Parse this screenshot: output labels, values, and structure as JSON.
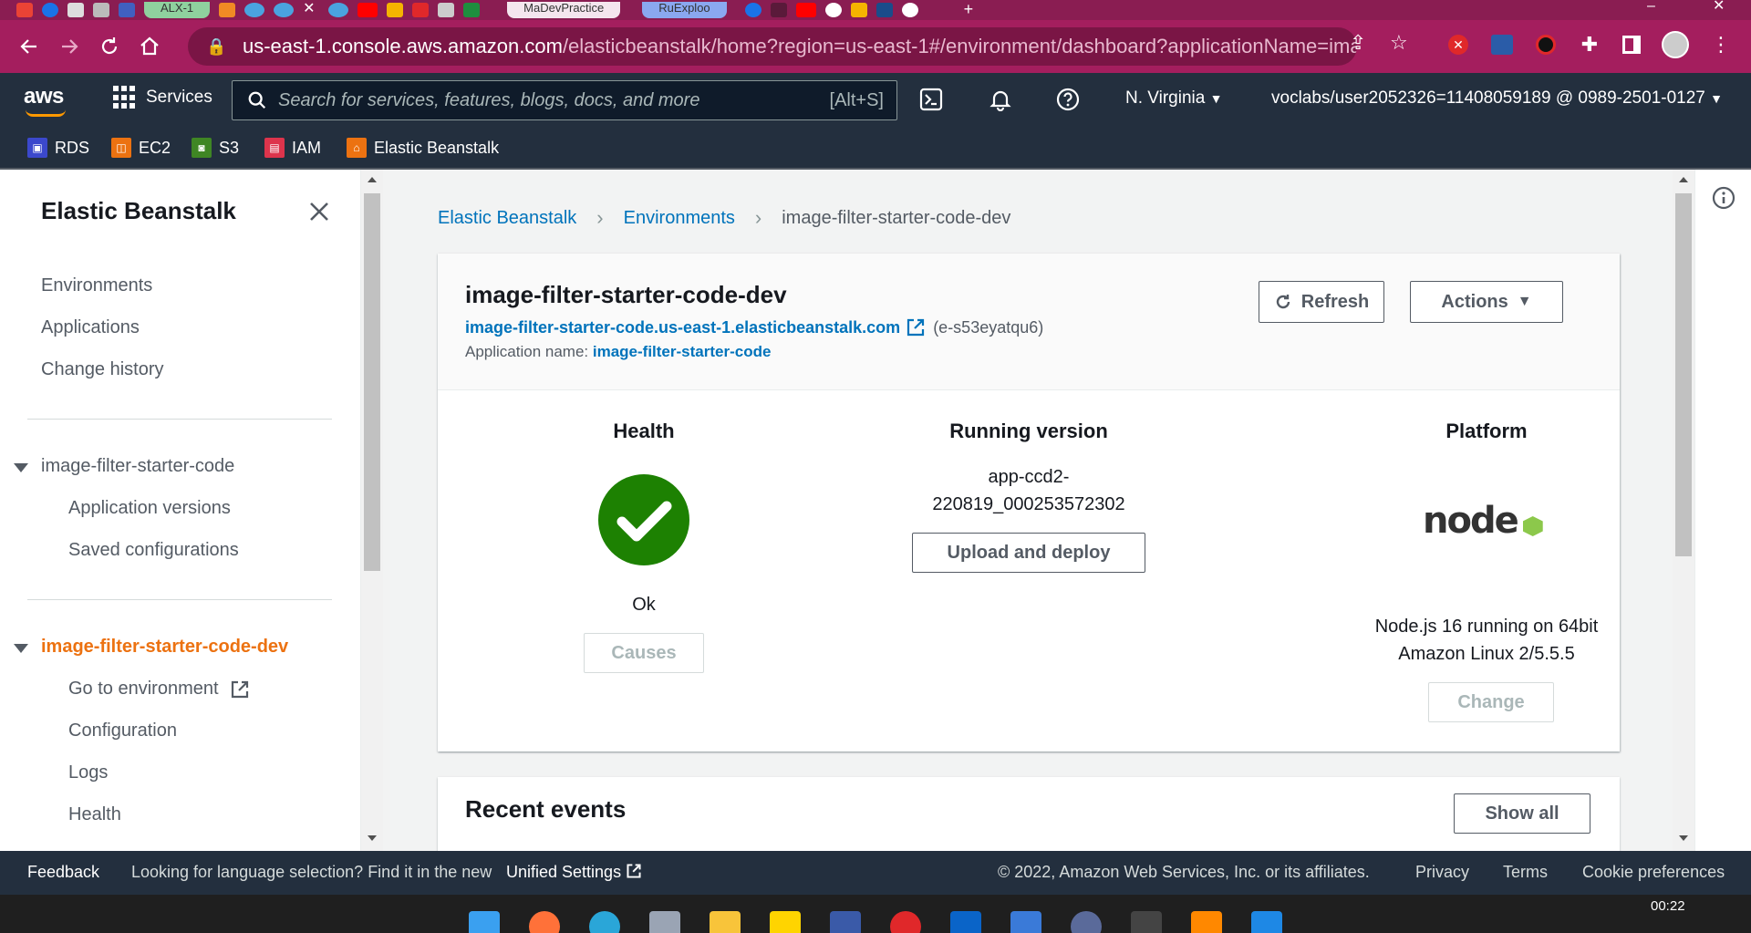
{
  "browser": {
    "tabs": [
      {
        "label": "ALX-1"
      },
      {
        "label": "MaDevPractice"
      },
      {
        "label": "RuExploo"
      }
    ],
    "url_host": "us-east-1.console.aws.amazon.com",
    "url_path": "/elasticbeanstalk/home?region=us-east-1#/environment/dashboard?applicationName=imag..."
  },
  "aws_nav": {
    "logo": "aws",
    "services_label": "Services",
    "search_placeholder": "Search for services, features, blogs, docs, and more",
    "search_shortcut": "[Alt+S]",
    "region": "N. Virginia",
    "account": "voclabs/user2052326=11408059189 @ 0989-2501-0127"
  },
  "favorites": [
    {
      "label": "RDS",
      "color": "#3b48cc"
    },
    {
      "label": "EC2",
      "color": "#ec7211"
    },
    {
      "label": "S3",
      "color": "#3f8624"
    },
    {
      "label": "IAM",
      "color": "#dd344c"
    },
    {
      "label": "Elastic Beanstalk",
      "color": "#ec7211"
    }
  ],
  "sidebar": {
    "title": "Elastic Beanstalk",
    "top_links": [
      "Environments",
      "Applications",
      "Change history"
    ],
    "app_name": "image-filter-starter-code",
    "app_links": [
      "Application versions",
      "Saved configurations"
    ],
    "env_name": "image-filter-starter-code-dev",
    "env_links": [
      "Go to environment",
      "Configuration",
      "Logs",
      "Health"
    ]
  },
  "breadcrumb": {
    "root": "Elastic Beanstalk",
    "middle": "Environments",
    "current": "image-filter-starter-code-dev"
  },
  "environment": {
    "title": "image-filter-starter-code-dev",
    "url": "image-filter-starter-code.us-east-1.elasticbeanstalk.com",
    "env_id": "(e-s53eyatqu6)",
    "app_name_label": "Application name:",
    "app_name_value": "image-filter-starter-code",
    "refresh_label": "Refresh",
    "actions_label": "Actions"
  },
  "health": {
    "heading": "Health",
    "status": "Ok",
    "causes_label": "Causes",
    "status_color": "#1d8102"
  },
  "running_version": {
    "heading": "Running version",
    "line1": "app-ccd2-",
    "line2": "220819_000253572302",
    "upload_label": "Upload and deploy"
  },
  "platform": {
    "heading": "Platform",
    "logo_text": "node",
    "line1": "Node.js 16 running on 64bit",
    "line2": "Amazon Linux 2/5.5.5",
    "change_label": "Change"
  },
  "recent_events": {
    "title": "Recent events",
    "show_all_label": "Show all"
  },
  "footer": {
    "feedback": "Feedback",
    "language_text": "Looking for language selection? Find it in the new",
    "unified_settings": "Unified Settings",
    "copyright": "© 2022, Amazon Web Services, Inc. or its affiliates.",
    "privacy": "Privacy",
    "terms": "Terms",
    "cookies": "Cookie preferences"
  },
  "taskbar": {
    "time": "00:22"
  }
}
